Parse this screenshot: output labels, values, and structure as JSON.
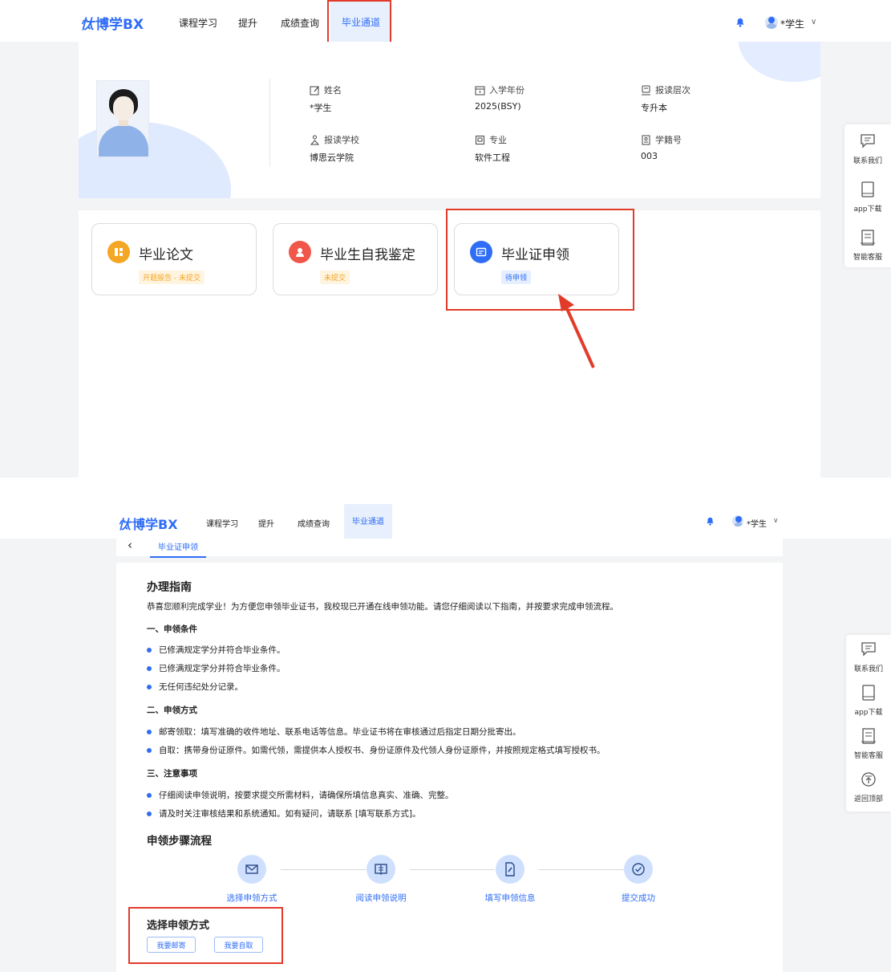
{
  "app": {
    "logo_mark": "忲",
    "logo_text": "博学BX"
  },
  "nav": [
    {
      "label": "课程学习"
    },
    {
      "label": "提升"
    },
    {
      "label": "成绩查询"
    },
    {
      "label": "毕业通道",
      "active": true
    }
  ],
  "user": {
    "name": "*学生"
  },
  "float_bar": {
    "contact": "联系我们",
    "app_download": "app下载",
    "service": "智能客服",
    "back_top": "返回顶部"
  },
  "profile": {
    "name_label": "姓名",
    "name_value": "*学生",
    "year_label": "入学年份",
    "year_value": "2025(BSY)",
    "level_label": "报读层次",
    "level_value": "专升本",
    "school_label": "报读学校",
    "school_value": "博思云学院",
    "major_label": "专业",
    "major_value": "软件工程",
    "id_label": "学籍号",
    "id_value": "003"
  },
  "cards": [
    {
      "title": "毕业论文",
      "badge": "开题报告 - 未提交",
      "color": "#f5a623",
      "badge_color": "#f5a623",
      "badge_bg": "#fff4e0"
    },
    {
      "title": "毕业生自我鉴定",
      "badge": "未提交",
      "color": "#f0564a",
      "badge_color": "#f5a623",
      "badge_bg": "#fff4e0"
    },
    {
      "title": "毕业证申领",
      "badge": "待申领",
      "color": "#2f6df6",
      "badge_color": "#2f6df6",
      "badge_bg": "#e5efff"
    }
  ],
  "breadcrumb": {
    "tab": "毕业证申领"
  },
  "guide": {
    "title": "办理指南",
    "intro": "恭喜您顺利完成学业！为方便您申领毕业证书，我校现已开通在线申领功能。请您仔细阅读以下指南，并按要求完成申领流程。",
    "sections": [
      {
        "title": "一、申领条件",
        "items": [
          "已修满规定学分并符合毕业条件。",
          "已修满规定学分并符合毕业条件。",
          "无任何违纪处分记录。"
        ]
      },
      {
        "title": "二、申领方式",
        "items": [
          "邮寄领取：填写准确的收件地址、联系电话等信息。毕业证书将在审核通过后指定日期分批寄出。",
          "自取：携带身份证原件。如需代领，需提供本人授权书、身份证原件及代领人身份证原件，并按照规定格式填写授权书。"
        ]
      },
      {
        "title": "三、注意事项",
        "items": [
          "仔细阅读申领说明，按要求提交所需材料，请确保所填信息真实、准确、完整。",
          "请及时关注审核结果和系统通知。如有疑问，请联系 [填写联系方式]。"
        ]
      }
    ]
  },
  "steps": {
    "title": "申领步骤流程",
    "items": [
      {
        "label": "选择申领方式",
        "icon": "mail-icon"
      },
      {
        "label": "阅读申领说明",
        "icon": "book-icon"
      },
      {
        "label": "填写申领信息",
        "icon": "edit-doc-icon"
      },
      {
        "label": "提交成功",
        "icon": "check-circle-icon"
      }
    ]
  },
  "choice": {
    "title": "选择申领方式",
    "mail": "我要邮寄",
    "self": "我要自取"
  },
  "colors": {
    "accent": "#2f6df6",
    "highlight": "#e23b2a"
  }
}
